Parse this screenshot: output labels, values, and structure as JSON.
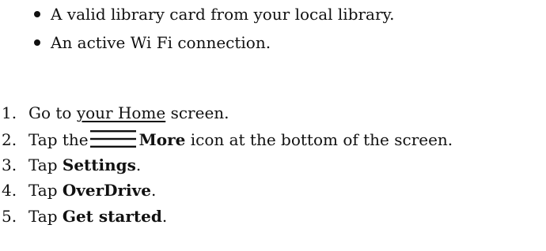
{
  "requirements": [
    "A valid library card from your local library.",
    "An active Wi Fi connection."
  ],
  "steps": {
    "s1": {
      "num": "1.",
      "pre": "Go to ",
      "link": "your Home",
      "post": " screen."
    },
    "s2": {
      "num": "2.",
      "pre": "Tap the",
      "bold": "More",
      "post": " icon at the bottom of the screen.",
      "icon": "menu-icon"
    },
    "s3": {
      "num": "3.",
      "pre": "Tap ",
      "bold": "Settings",
      "post": "."
    },
    "s4": {
      "num": "4.",
      "pre": "Tap ",
      "bold": "OverDrive",
      "post": "."
    },
    "s5": {
      "num": "5.",
      "pre": "Tap ",
      "bold": "Get started",
      "post": "."
    }
  }
}
